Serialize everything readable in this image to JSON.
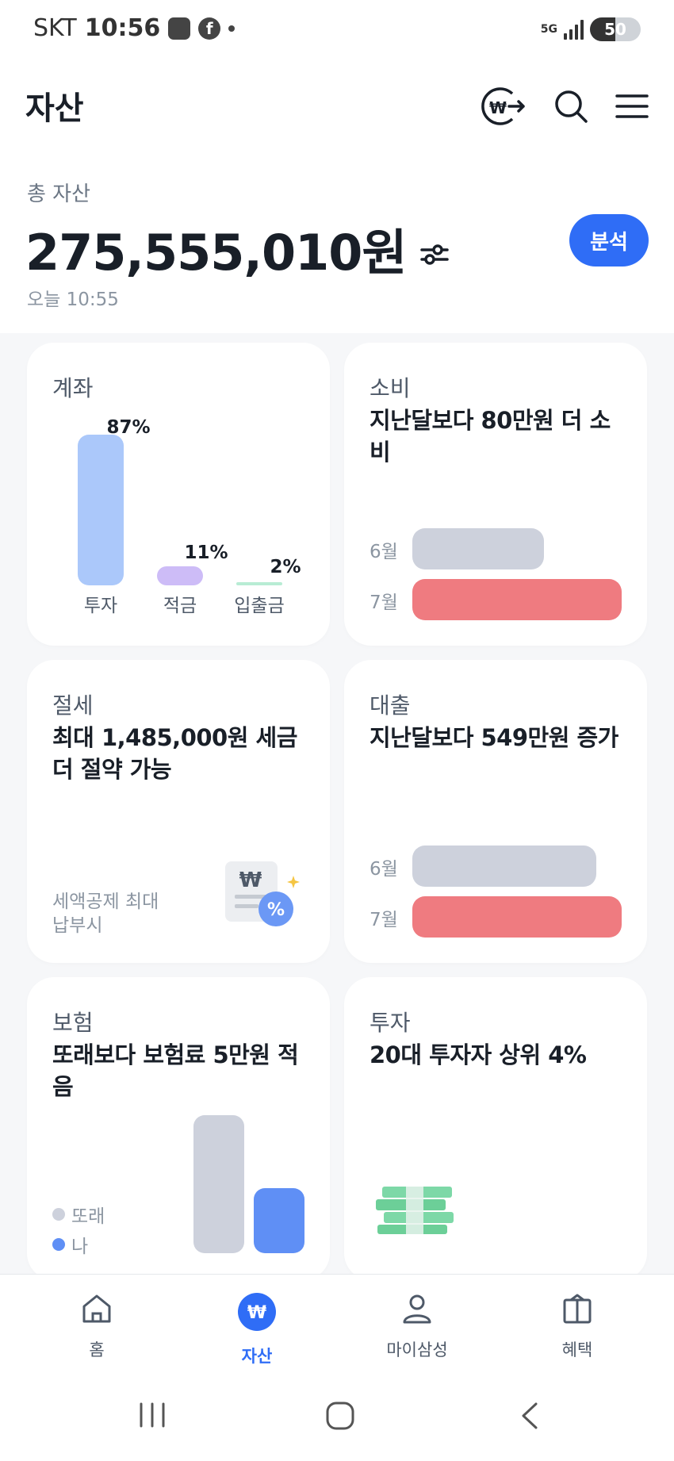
{
  "status_bar": {
    "carrier": "SKT",
    "time": "10:56",
    "network": "5G",
    "battery": "50",
    "battery_level": 0.5
  },
  "header": {
    "title": "자산",
    "icons": [
      "won-transfer-icon",
      "search-icon",
      "menu-icon"
    ]
  },
  "summary": {
    "label": "총 자산",
    "amount": "275,555,010원",
    "updated": "오늘 10:55",
    "analyze_button": "분석"
  },
  "cards": {
    "account": {
      "title": "계좌",
      "bars": [
        {
          "label": "투자",
          "pct": "87%",
          "value": 87,
          "color": "#abc8fa"
        },
        {
          "label": "적금",
          "pct": "11%",
          "value": 11,
          "color": "#cdbcf7"
        },
        {
          "label": "입출금",
          "pct": "2%",
          "value": 2,
          "color": "#b8ecd4"
        }
      ]
    },
    "spending": {
      "title": "소비",
      "headline": "지난달보다 80만원 더 소비",
      "rows": [
        {
          "label": "6월",
          "value": 0.63,
          "color": "#cdd1dc"
        },
        {
          "label": "7월",
          "value": 1.0,
          "color": "#ef7b80"
        }
      ]
    },
    "tax": {
      "title": "절세",
      "headline": "최대 1,485,000원 세금 더 절약 가능",
      "note": "세액공제 최대 납부시",
      "icon": "tax-document-icon"
    },
    "loan": {
      "title": "대출",
      "headline": "지난달보다 549만원 증가",
      "rows": [
        {
          "label": "6월",
          "value": 0.88,
          "color": "#cdd1dc"
        },
        {
          "label": "7월",
          "value": 1.0,
          "color": "#ef7b80"
        }
      ]
    },
    "insurance": {
      "title": "보험",
      "headline": "또래보다 보험료 5만원 적음",
      "legend": [
        {
          "label": "또래",
          "color": "#cdd1dc",
          "value": 1.0
        },
        {
          "label": "나",
          "color": "#5f8ff5",
          "value": 0.47
        }
      ]
    },
    "invest": {
      "title": "투자",
      "headline": "20대 투자자 상위 4%",
      "icon": "money-stack-icon"
    }
  },
  "bottom_nav": [
    {
      "label": "홈",
      "icon": "home-icon",
      "active": false
    },
    {
      "label": "자산",
      "icon": "won-circle-icon",
      "active": true
    },
    {
      "label": "마이삼성",
      "icon": "person-icon",
      "active": false
    },
    {
      "label": "혜택",
      "icon": "gift-icon",
      "active": false
    }
  ],
  "system_nav": [
    "recent-apps-icon",
    "home-button-icon",
    "back-icon"
  ]
}
